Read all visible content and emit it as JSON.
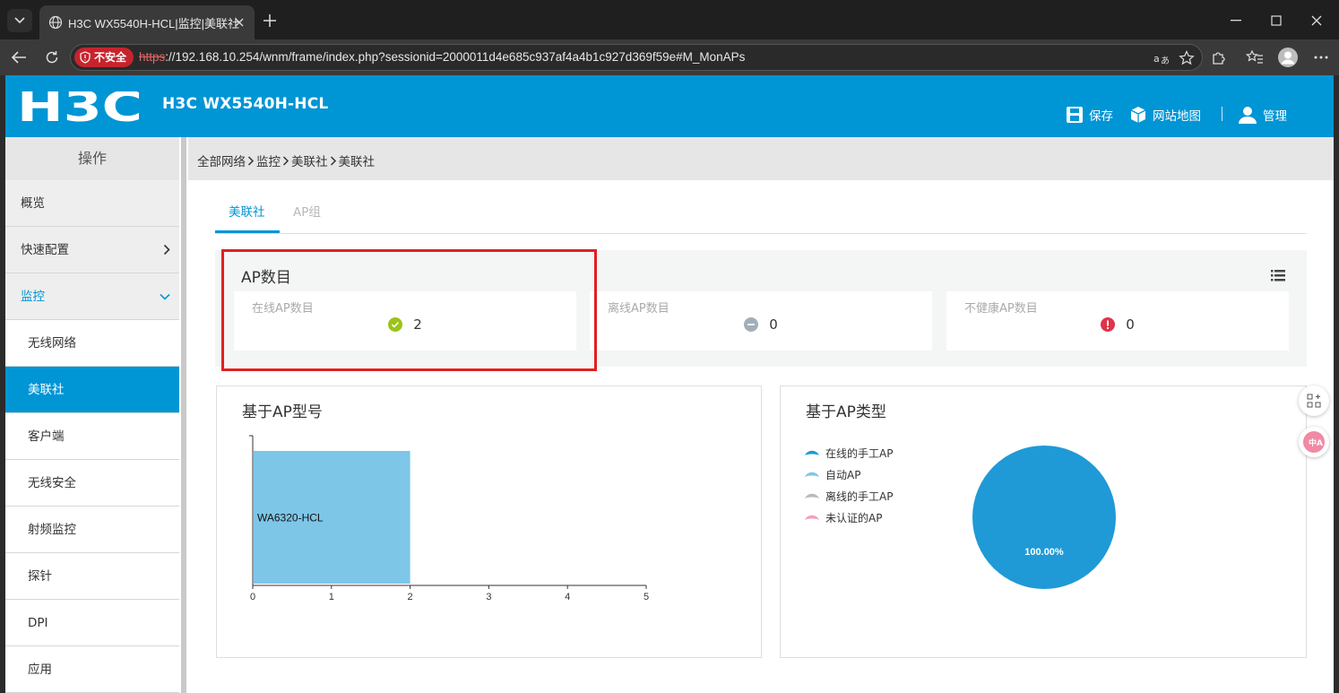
{
  "browser": {
    "tab_title": "H3C WX5540H-HCL|监控|美联社",
    "security_label": "不安全",
    "url_scheme": "https",
    "url_rest": "://192.168.10.254/wnm/frame/index.php?sessionid=2000011d4e685c937af4a4b1c927d369f59e#M_MonAPs"
  },
  "header": {
    "logo_text": "H3C",
    "device_name": "H3C WX5540H-HCL",
    "save_label": "保存",
    "sitemap_label": "网站地图",
    "admin_label": "管理"
  },
  "sidebar": {
    "title": "操作",
    "items": [
      {
        "label": "概览"
      },
      {
        "label": "快速配置"
      },
      {
        "label": "监控"
      },
      {
        "label": "无线网络"
      },
      {
        "label": "美联社"
      },
      {
        "label": "客户端"
      },
      {
        "label": "无线安全"
      },
      {
        "label": "射频监控"
      },
      {
        "label": "探针"
      },
      {
        "label": "DPI"
      },
      {
        "label": "应用"
      }
    ]
  },
  "breadcrumb": [
    "全部网络",
    "监控",
    "美联社",
    "美联社"
  ],
  "tabs": [
    {
      "label": "美联社"
    },
    {
      "label": "AP组"
    }
  ],
  "ap_count": {
    "title": "AP数目",
    "online_label": "在线AP数目",
    "online_value": "2",
    "offline_label": "离线AP数目",
    "offline_value": "0",
    "unhealthy_label": "不健康AP数目",
    "unhealthy_value": "0"
  },
  "model_chart": {
    "title": "基于AP型号"
  },
  "type_chart": {
    "title": "基于AP类型",
    "legend": [
      {
        "label": "在线的手工AP",
        "color": "#1f9ad6"
      },
      {
        "label": "自动AP",
        "color": "#7ac7e8"
      },
      {
        "label": "离线的手工AP",
        "color": "#b9b9b9"
      },
      {
        "label": "未认证的AP",
        "color": "#f4a0b5"
      }
    ],
    "slice_label": "100.00%"
  },
  "chart_data": [
    {
      "type": "bar",
      "orientation": "horizontal",
      "categories": [
        "WA6320-HCL"
      ],
      "values": [
        2
      ],
      "xlim": [
        0,
        5
      ],
      "xticks": [
        0,
        1,
        2,
        3,
        4,
        5
      ],
      "color": "#7ec6e8"
    },
    {
      "type": "pie",
      "labels": [
        "在线的手工AP",
        "自动AP",
        "离线的手工AP",
        "未认证的AP"
      ],
      "values": [
        100,
        0,
        0,
        0
      ],
      "colors": [
        "#1f9ad6",
        "#7ac7e8",
        "#b9b9b9",
        "#f4a0b5"
      ]
    }
  ]
}
